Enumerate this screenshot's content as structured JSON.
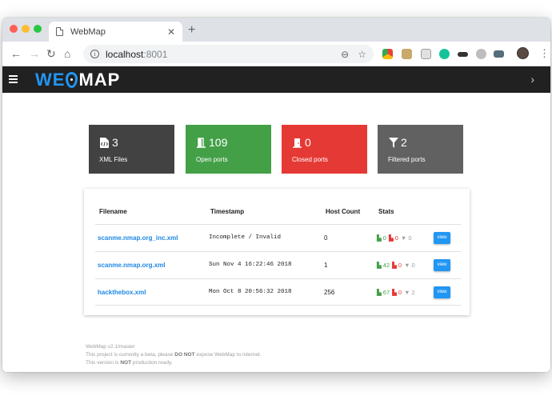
{
  "browser": {
    "tab_title": "WebMap",
    "tab_close": "✕",
    "new_tab": "+",
    "url_host": "localhost",
    "url_port": ":8001"
  },
  "app": {
    "logo_we": "WE",
    "logo_map": "MAP"
  },
  "stats": [
    {
      "count": "3",
      "label": "XML Files",
      "color": "#424242",
      "icon": "file-code-icon"
    },
    {
      "count": "109",
      "label": "Open ports",
      "color": "#43a047",
      "icon": "door-open-icon"
    },
    {
      "count": "0",
      "label": "Closed ports",
      "color": "#e53935",
      "icon": "door-closed-icon"
    },
    {
      "count": "2",
      "label": "Filtered ports",
      "color": "#616161",
      "icon": "filter-icon"
    }
  ],
  "table": {
    "headers": [
      "Filename",
      "Timestamp",
      "Host Count",
      "Stats"
    ],
    "rows": [
      {
        "filename": "scanme.nmap.org_inc.xml",
        "timestamp": "Incomplete / Invalid",
        "hosts": "0",
        "open": "0",
        "closed": "0",
        "filtered": "0",
        "action": "view"
      },
      {
        "filename": "scanme.nmap.org.xml",
        "timestamp": "Sun Nov 4 16:22:46 2018",
        "hosts": "1",
        "open": "42",
        "closed": "0",
        "filtered": "0",
        "action": "view"
      },
      {
        "filename": "hackthebox.xml",
        "timestamp": "Mon Oct 8 20:56:32 2018",
        "hosts": "256",
        "open": "67",
        "closed": "0",
        "filtered": "2",
        "action": "view"
      }
    ]
  },
  "footer": {
    "version": "WebMap v2.1/master",
    "line2_pre": "This project is currently a beta, please ",
    "line2_bold": "DO NOT",
    "line2_post": " expose WebMap to internet.",
    "line3_pre": "This version is ",
    "line3_bold": "NOT",
    "line3_post": " production ready."
  },
  "colors": {
    "accent": "#2196f3",
    "open": "#43a047",
    "closed": "#e53935",
    "filtered": "#9e9e9e"
  }
}
